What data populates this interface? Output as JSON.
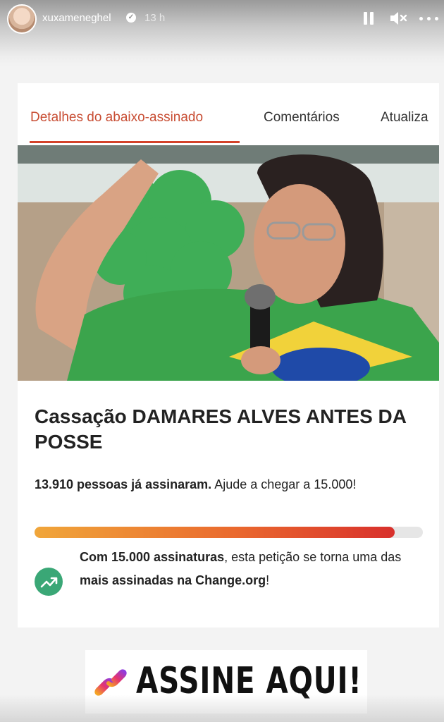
{
  "story": {
    "username": "xuxameneghel",
    "time": "13 h",
    "icons": [
      "avatar",
      "verified-icon",
      "pause-icon",
      "mute-icon",
      "more-icon"
    ]
  },
  "petition": {
    "tabs": [
      {
        "label": "Detalhes do abaixo-assinado",
        "active": true
      },
      {
        "label": "Comentários",
        "active": false
      },
      {
        "label": "Atualiza",
        "active": false
      }
    ],
    "title": "Cassação DAMARES ALVES ANTES DA POSSE",
    "signed_bold": "13.910 pessoas já assinaram.",
    "signed_rest": " Ajude a chegar a 15.000!",
    "progress": {
      "current": 13910,
      "goal": 15000
    },
    "goal_parts": {
      "p1": "Com 15.000 assinaturas",
      "p2": ", esta petição se torna uma das ",
      "p3": "mais assinadas na Change.org",
      "p4": "!"
    }
  },
  "cta": {
    "label": "ASSINE AQUI!"
  },
  "colors": {
    "tab_active": "#c84d33",
    "underline": "#d4422a",
    "goal_icon": "#3aa776",
    "progress_start": "#f0a63a",
    "progress_end": "#d8302c"
  }
}
